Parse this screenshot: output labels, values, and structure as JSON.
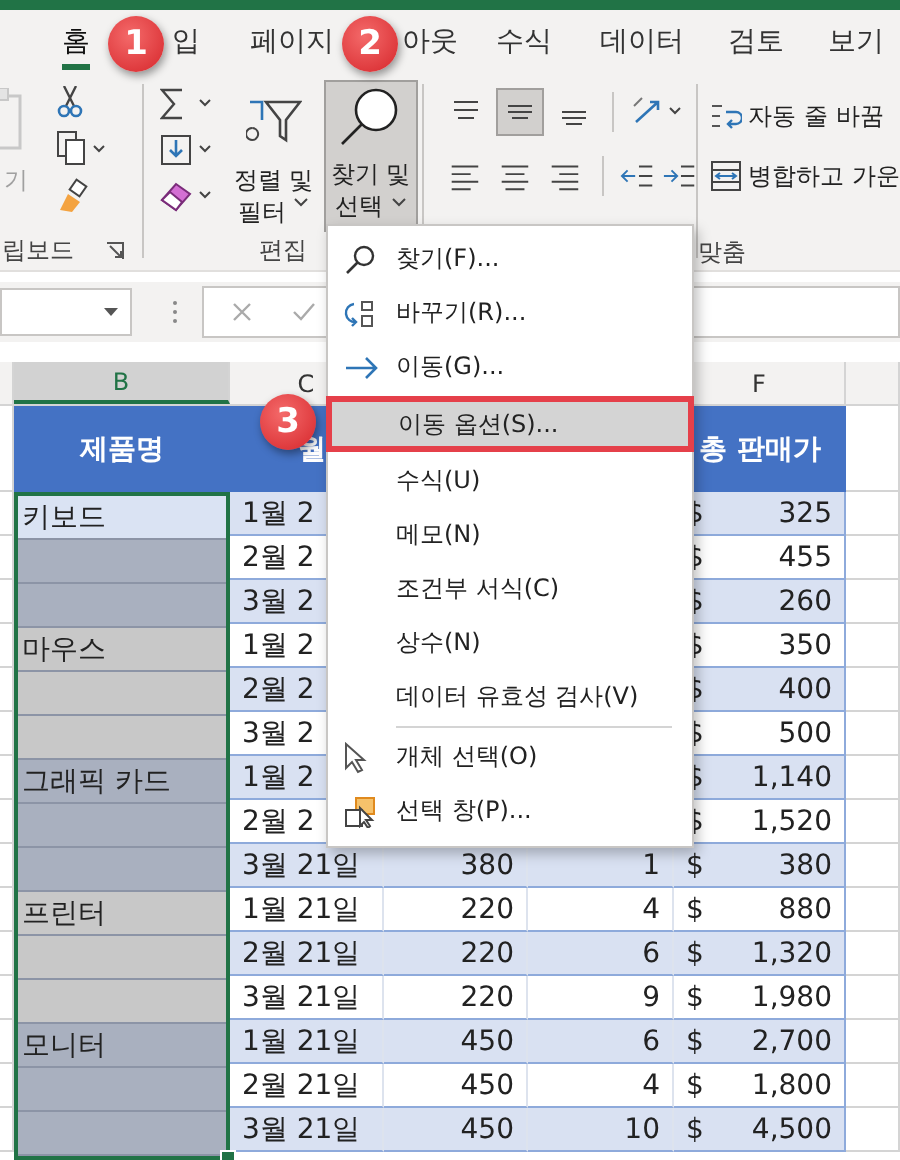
{
  "tabs": [
    {
      "label": "홈",
      "selected": true
    },
    {
      "label": "입",
      "selected": false
    },
    {
      "label": "페이지",
      "selected": false
    },
    {
      "label": "아웃",
      "selected": false
    },
    {
      "label": "수식",
      "selected": false
    },
    {
      "label": "데이터",
      "selected": false
    },
    {
      "label": "검토",
      "selected": false
    },
    {
      "label": "보기",
      "selected": false
    }
  ],
  "ribbon": {
    "clipboard": {
      "paste_label": "기",
      "group_label": "립보드"
    },
    "editing": {
      "sort_label": "정렬 및",
      "sort_label_2": "필터",
      "find_label": "찾기 및",
      "find_label_2": "선택",
      "find_pressed": true,
      "group_label": "편집"
    },
    "alignment": {
      "wrap_label": "자동 줄 바꿈",
      "merge_label": "병합하고 가운",
      "group_label": "맞춤"
    }
  },
  "column_headers": [
    {
      "selected": false
    },
    {
      "label": "B",
      "selected": true
    },
    {
      "label": "C",
      "selected": false
    },
    {
      "label": "F",
      "selected": false
    },
    {
      "selected": false
    }
  ],
  "sheet": {
    "header": {
      "column_b": "제품명",
      "column_c": "월",
      "column_f": "총 판매가"
    },
    "products": [
      {
        "name": "키보드",
        "color": "#a9b0bf",
        "active": true,
        "rows": [
          {
            "date": "1월 2",
            "currency": "$",
            "total": "325"
          },
          {
            "date": "2월 2",
            "currency": "$",
            "total": "455"
          },
          {
            "date": "3월 2",
            "currency": "$",
            "total": "260"
          }
        ]
      },
      {
        "name": "마우스",
        "color": "#c8c8c8",
        "active": false,
        "rows": [
          {
            "date": "1월 2",
            "currency": "$",
            "total": "350"
          },
          {
            "date": "2월 2",
            "currency": "$",
            "total": "400"
          },
          {
            "date": "3월 2",
            "currency": "$",
            "total": "500"
          }
        ]
      },
      {
        "name": "그래픽 카드",
        "color": "#a9b0bf",
        "active": false,
        "rows": [
          {
            "date": "1월 2",
            "currency": "$",
            "total": "1,140"
          },
          {
            "date": "2월 2",
            "currency": "$",
            "total": "1,520"
          },
          {
            "date": "3월 21일",
            "price": "380",
            "qty": "1",
            "currency": "$",
            "total": "380"
          }
        ]
      },
      {
        "name": "프린터",
        "color": "#c8c8c8",
        "active": false,
        "rows": [
          {
            "date": "1월 21일",
            "price": "220",
            "qty": "4",
            "currency": "$",
            "total": "880"
          },
          {
            "date": "2월 21일",
            "price": "220",
            "qty": "6",
            "currency": "$",
            "total": "1,320"
          },
          {
            "date": "3월 21일",
            "price": "220",
            "qty": "9",
            "currency": "$",
            "total": "1,980"
          }
        ]
      },
      {
        "name": "모니터",
        "color": "#a9b0bf",
        "active": false,
        "rows": [
          {
            "date": "1월 21일",
            "price": "450",
            "qty": "6",
            "currency": "$",
            "total": "2,700"
          },
          {
            "date": "2월 21일",
            "price": "450",
            "qty": "4",
            "currency": "$",
            "total": "1,800"
          },
          {
            "date": "3월 21일",
            "price": "450",
            "qty": "10",
            "currency": "$",
            "total": "4,500"
          }
        ]
      }
    ]
  },
  "menu": {
    "items": [
      {
        "label": "찾기(F)...",
        "selected": false,
        "separator_before": false
      },
      {
        "label": "바꾸기(R)...",
        "selected": false,
        "separator_before": false
      },
      {
        "label": "이동(G)...",
        "selected": false,
        "separator_before": false
      },
      {
        "label": "이동 옵션(S)...",
        "selected": true,
        "separator_before": false
      },
      {
        "label": "수식(U)",
        "selected": false,
        "separator_before": false
      },
      {
        "label": "메모(N)",
        "selected": false,
        "separator_before": false
      },
      {
        "label": "조건부 서식(C)",
        "selected": false,
        "separator_before": false
      },
      {
        "label": "상수(N)",
        "selected": false,
        "separator_before": false
      },
      {
        "label": "데이터 유효성 검사(V)",
        "selected": false,
        "separator_before": false
      },
      {
        "label": "개체 선택(O)",
        "selected": false,
        "separator_before": true
      },
      {
        "label": "선택 창(P)...",
        "selected": false,
        "separator_before": false
      }
    ]
  },
  "callouts": [
    "1",
    "2",
    "3"
  ]
}
